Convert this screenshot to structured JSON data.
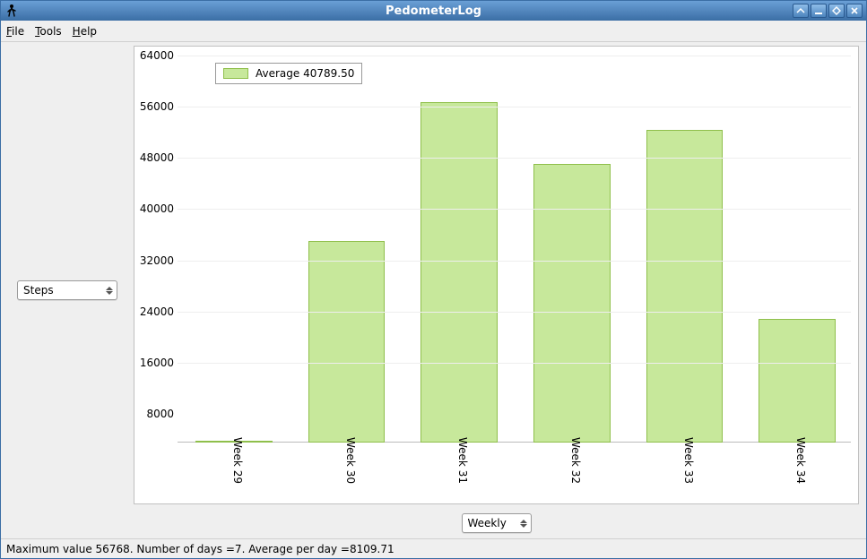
{
  "window": {
    "title": "PedometerLog"
  },
  "menubar": {
    "file": "File",
    "tools": "Tools",
    "help": "Help"
  },
  "left_combo": {
    "value": "Steps"
  },
  "bottom_combo": {
    "value": "Weekly"
  },
  "statusbar": {
    "text": "Maximum value 56768. Number of days =7. Average per day =8109.71"
  },
  "legend": {
    "text": "Average 40789.50"
  },
  "yticks": [
    "8000",
    "16000",
    "24000",
    "32000",
    "40000",
    "48000",
    "56000",
    "64000"
  ],
  "xticks": [
    "Week 29",
    "Week 30",
    "Week 31",
    "Week 32",
    "Week 33",
    "Week 34"
  ],
  "chart_data": {
    "type": "bar",
    "title": "",
    "xlabel": "",
    "ylabel": "",
    "ylim": [
      8000,
      64000
    ],
    "categories": [
      "Week 29",
      "Week 30",
      "Week 31",
      "Week 32",
      "Week 33",
      "Week 34"
    ],
    "values": [
      8300,
      39500,
      61200,
      51600,
      56800,
      27300
    ],
    "legend_text": "Average 40789.50",
    "average": 40789.5,
    "average_per_day": 8109.71,
    "max_value": 56768,
    "n_days": 7
  }
}
